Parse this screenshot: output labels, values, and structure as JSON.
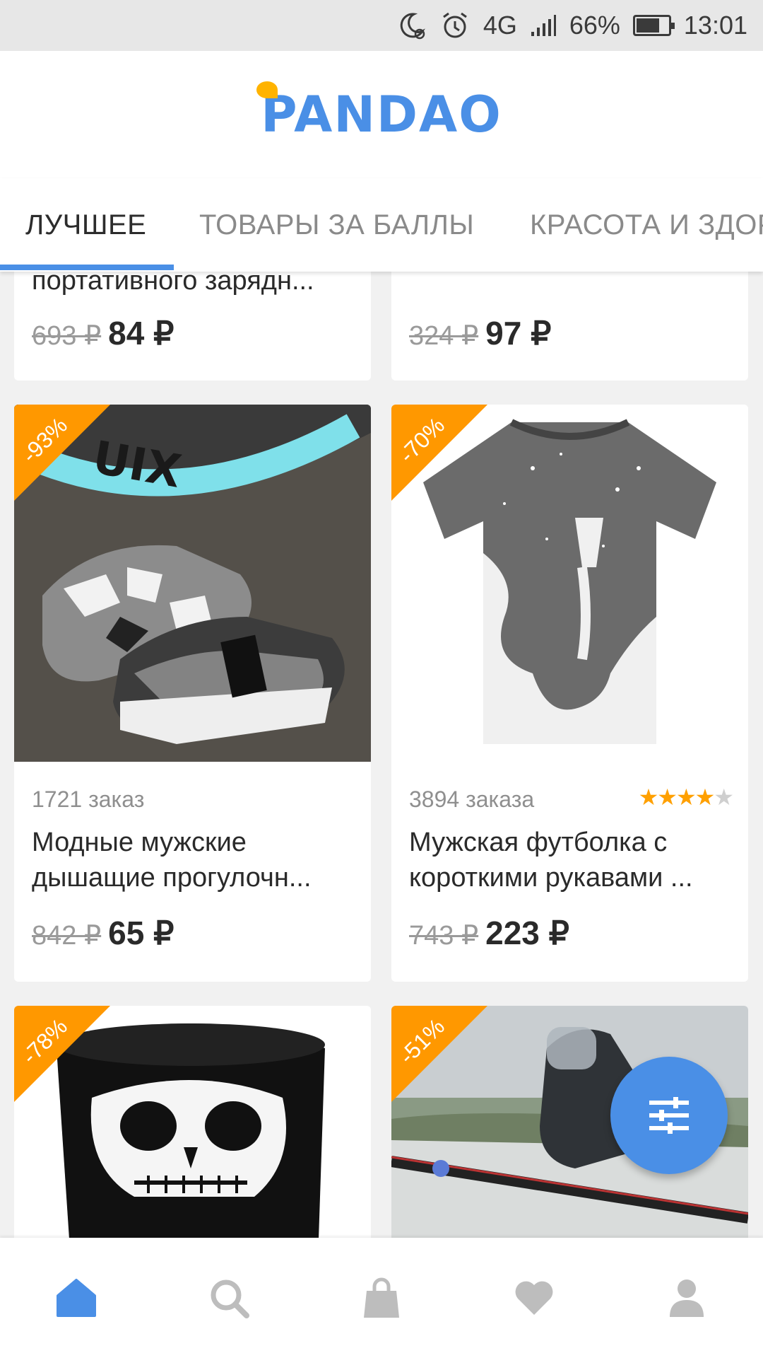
{
  "status_bar": {
    "network": "4G",
    "battery_percent": "66%",
    "battery_level": 0.66,
    "time": "13:01",
    "icons": [
      "moon-icon",
      "alarm-icon",
      "signal-icon",
      "battery-icon"
    ]
  },
  "header": {
    "logo_text": "PANDAO"
  },
  "tabs": [
    {
      "label": "ЛУЧШЕЕ",
      "active": true
    },
    {
      "label": "ТОВАРЫ ЗА БАЛЛЫ",
      "active": false
    },
    {
      "label": "КРАСОТА И ЗДОР",
      "active": false
    }
  ],
  "products_top": [
    {
      "title_tail": "портативного зарядн...",
      "old_price": "693 ₽",
      "price": "84 ₽"
    },
    {
      "old_price": "324 ₽",
      "price": "97 ₽"
    }
  ],
  "products": [
    {
      "discount": "-93%",
      "orders": "1721 заказ",
      "title": "Модные мужские дышащие прогулочн...",
      "old_price": "842 ₽",
      "price": "65 ₽",
      "image": "sneakers-image"
    },
    {
      "discount": "-70%",
      "orders": "3894 заказа",
      "rating": 4.5,
      "title": "Мужская футболка с короткими рукавами ...",
      "old_price": "743 ₽",
      "price": "223 ₽",
      "image": "tshirt-image"
    },
    {
      "discount": "-78%",
      "image": "skull-mask-image"
    },
    {
      "discount": "-51%",
      "image": "fishing-alarm-image"
    }
  ],
  "fab": {
    "icon": "filter-icon"
  },
  "bottom_nav": [
    {
      "icon": "home-icon",
      "active": true
    },
    {
      "icon": "search-icon",
      "active": false
    },
    {
      "icon": "bag-icon",
      "active": false
    },
    {
      "icon": "heart-icon",
      "active": false
    },
    {
      "icon": "profile-icon",
      "active": false
    }
  ],
  "colors": {
    "accent": "#4a8fe6",
    "badge": "#ff9800",
    "star": "#ffa000"
  }
}
